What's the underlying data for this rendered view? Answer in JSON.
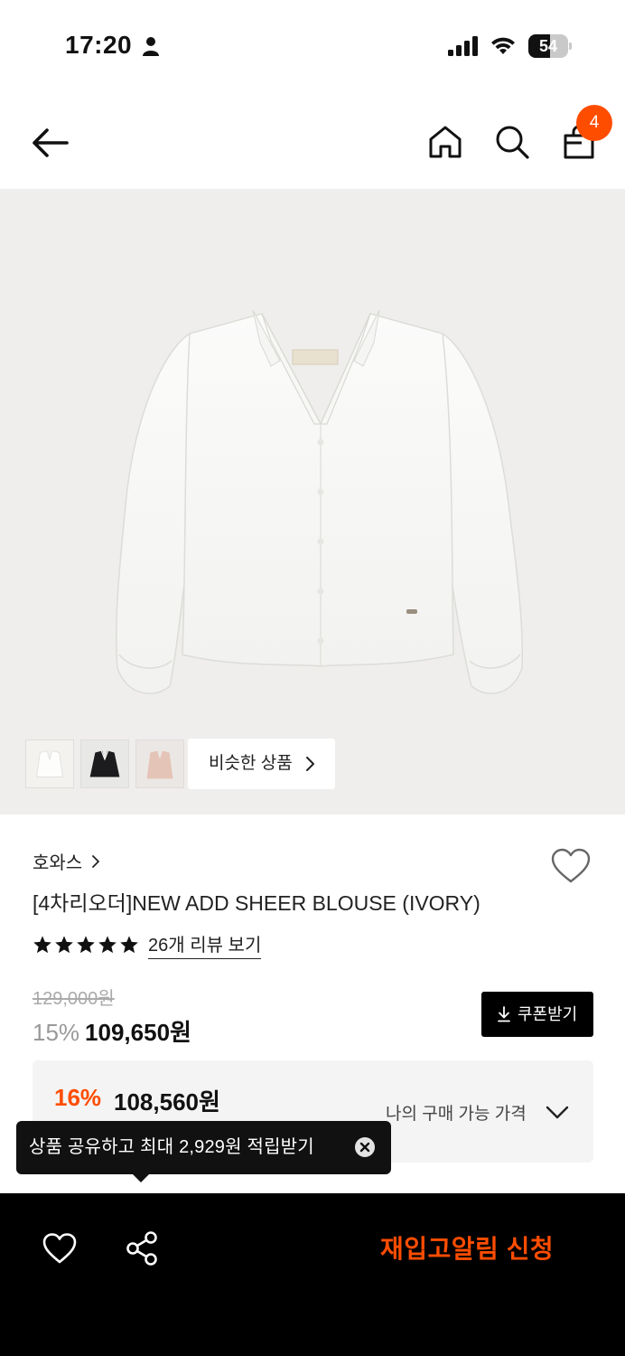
{
  "status_bar": {
    "time": "17:20",
    "battery": "54",
    "battery_level": 0.54
  },
  "header": {
    "cart_count": "4",
    "accent_color": "#ff4d00"
  },
  "icons": {
    "back": "back-arrow-icon",
    "home": "home-icon",
    "search": "search-icon",
    "bag": "shopping-bag-icon",
    "wishlist": "heart-icon",
    "share": "share-icon"
  },
  "gallery": {
    "thumbnails": [
      "ivory",
      "black",
      "pink"
    ],
    "similar_label": "비슷한 상품"
  },
  "product": {
    "brand": "호와스",
    "title": "[4차리오더]NEW ADD SHEER BLOUSE (IVORY)",
    "rating_stars": 5,
    "review_link": "26개 리뷰 보기",
    "original_price": "129,000원",
    "discount": "15%",
    "sale_price": "109,650원",
    "coupon_label": "쿠폰받기"
  },
  "my_price": {
    "discount": "16%",
    "price": "108,560원",
    "label": "나의 구매 가능 가격"
  },
  "tooltip": {
    "text": "상품 공유하고 최대 2,929원 적립받기"
  },
  "bottom_bar": {
    "restock_label": "재입고알림 신청"
  }
}
